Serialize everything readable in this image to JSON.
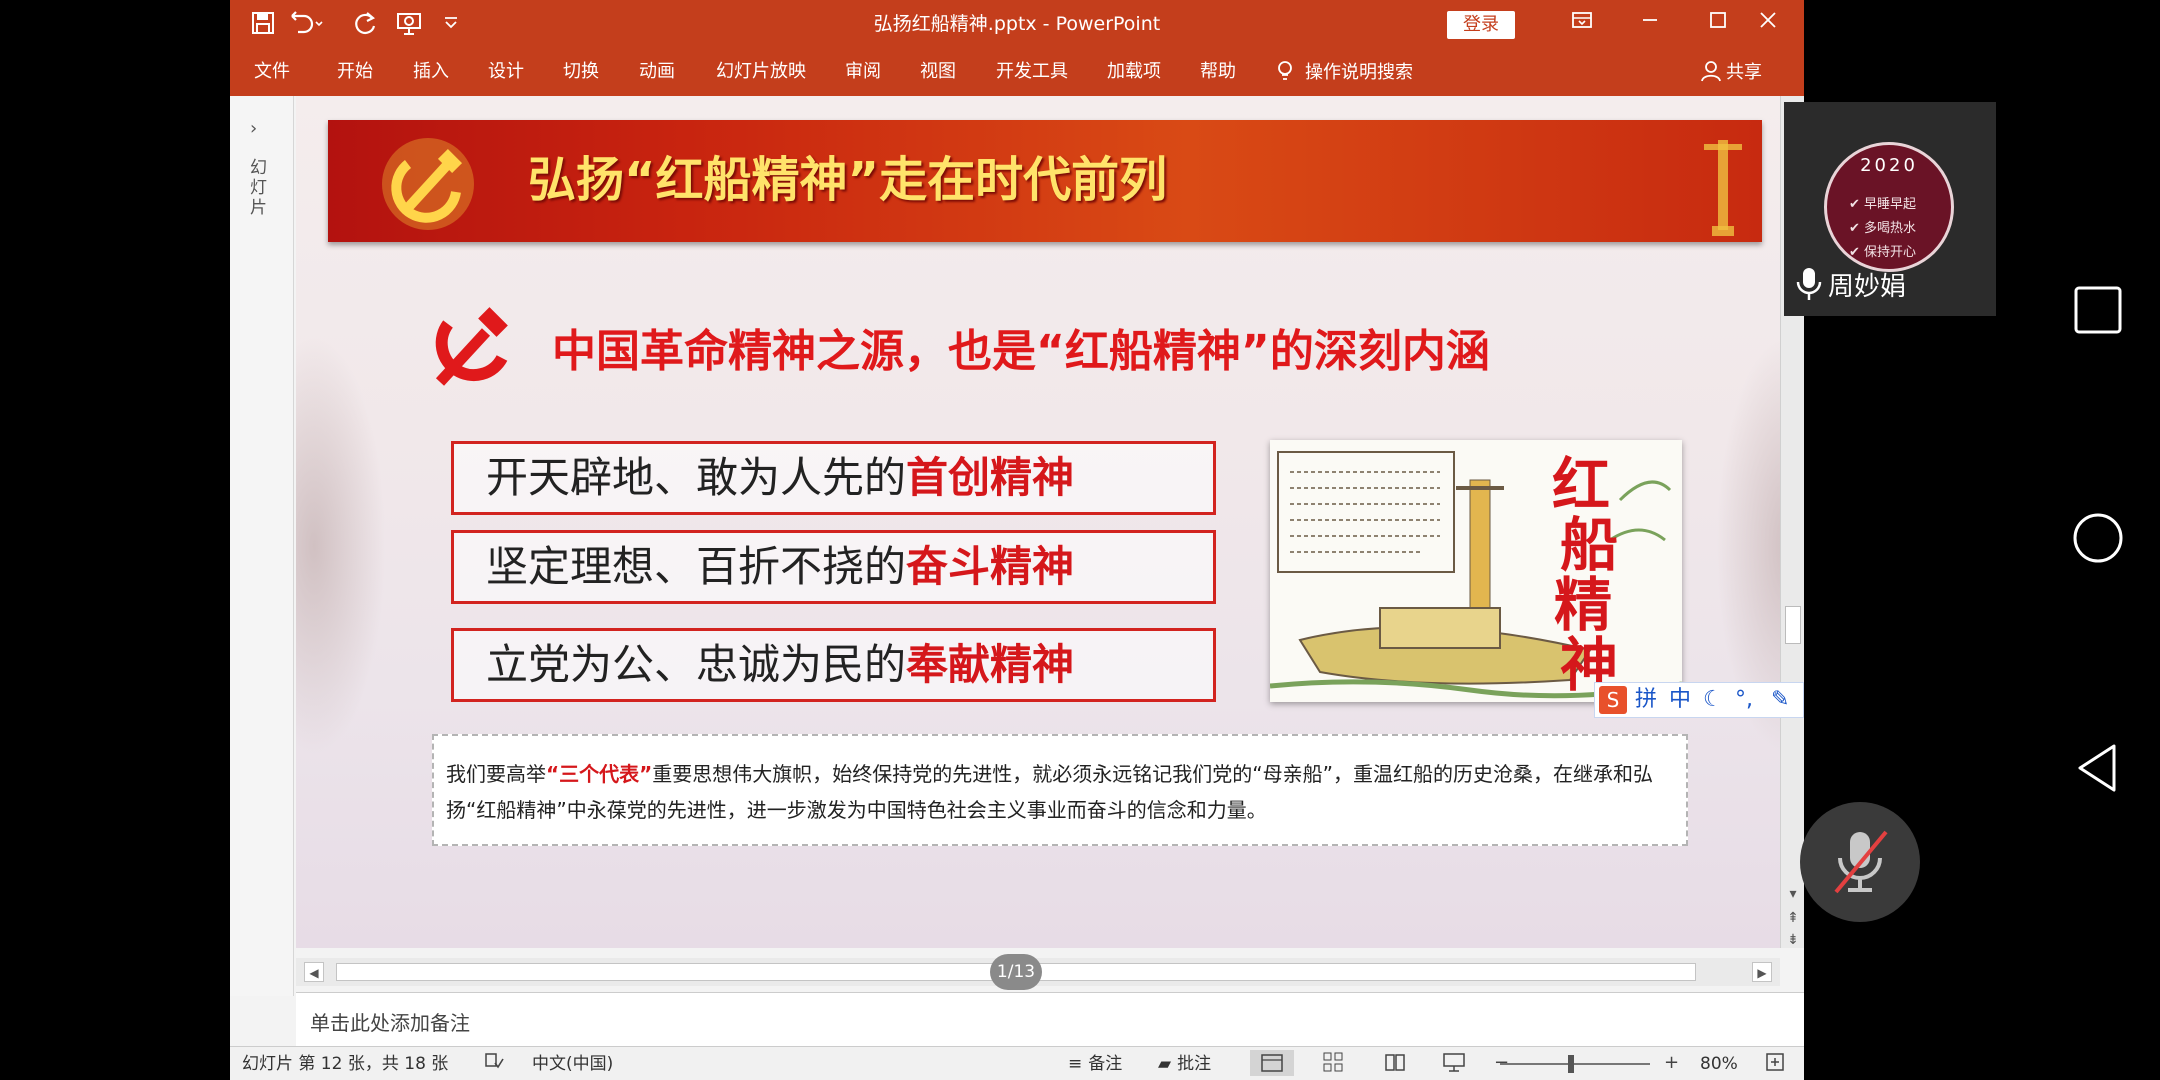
{
  "window": {
    "title": "弘扬红船精神.pptx  -  PowerPoint",
    "login_label": "登录",
    "icons": [
      "save-icon",
      "undo-icon",
      "redo-icon",
      "presenter-icon",
      "customize-qat-icon",
      "ribbon-display-icon",
      "minimize-icon",
      "maximize-icon",
      "close-icon"
    ]
  },
  "ribbon": {
    "tabs": [
      "文件",
      "开始",
      "插入",
      "设计",
      "切换",
      "动画",
      "幻灯片放映",
      "审阅",
      "视图",
      "开发工具",
      "加载项",
      "帮助"
    ],
    "tell_me": "操作说明搜索",
    "share": "共享"
  },
  "thumbnail_pane": {
    "label": "幻灯片"
  },
  "slide": {
    "banner_title": "弘扬“红船精神”走在时代前列",
    "heading": "中国革命精神之源，也是“红船精神”的深刻内涵",
    "points": [
      {
        "plain": "开天辟地、敢为人先的",
        "accent": "首创精神"
      },
      {
        "plain": "坚定理想、百折不挠的",
        "accent": "奋斗精神"
      },
      {
        "plain": "立党为公、忠诚为民的",
        "accent": "奉献精神"
      }
    ],
    "image_caption_chars": [
      "红",
      "船",
      "精",
      "神"
    ],
    "body": {
      "part1": "我们要高举",
      "quote": "“三个代表”",
      "part2": "重要思想伟大旗帜，始终保持党的先进性，就必须永远铭记我们党的“母亲船”，重温红船的历史沧桑，在继承和弘扬“红船精神”中永葆党的先进性，进一步激发为中国特色社会主义事业而奋斗的信念和力量。"
    }
  },
  "ime": {
    "labels": [
      "拼",
      "中"
    ]
  },
  "page_indicator": "1/13",
  "notes": {
    "placeholder": "单击此处添加备注"
  },
  "status": {
    "slide_info": "幻灯片 第 12 张，共 18 张",
    "language": "中文(中国)",
    "notes_label": "备注",
    "comments_label": "批注",
    "zoom": "80%"
  },
  "overlay": {
    "badge_year": "2020",
    "badge_lines": [
      "早睡早起",
      "多喝热水",
      "保持开心"
    ],
    "name": "周妙娟"
  },
  "colors": {
    "ribbon": "#c43e1c",
    "accent_red": "#d5171b",
    "banner_gold": "#ffe36a"
  }
}
